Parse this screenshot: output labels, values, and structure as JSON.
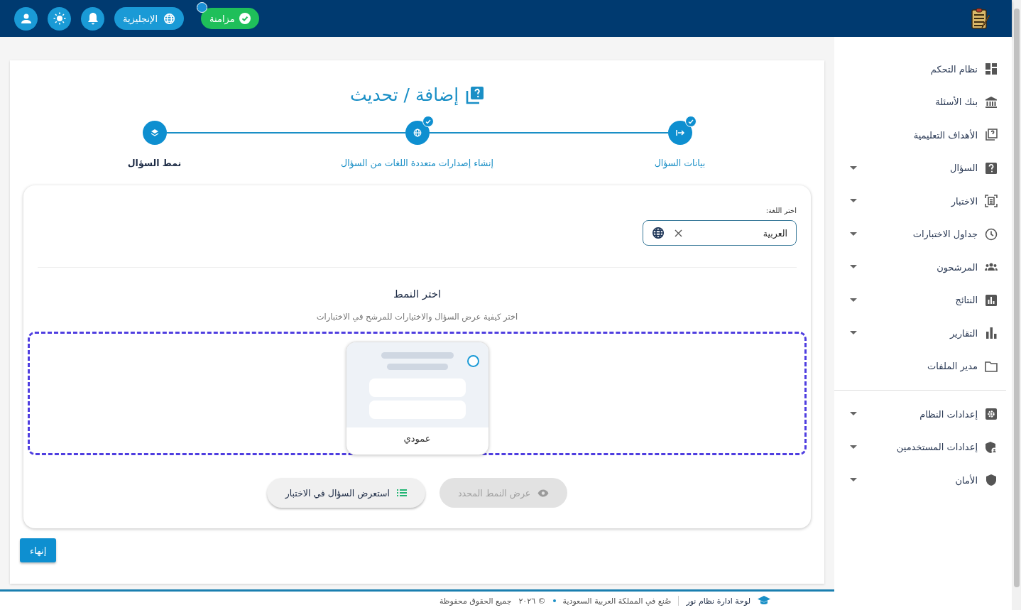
{
  "topbar": {
    "sync": {
      "label": "مزامنة",
      "synced": true
    },
    "language_button": "الإنجليزية"
  },
  "sidebar": {
    "sections": [
      {
        "items": [
          {
            "label": "نظام التحكم",
            "expandable": false
          },
          {
            "label": "بنك الأسئلة",
            "expandable": false
          },
          {
            "label": "الأهداف التعليمية",
            "expandable": false
          },
          {
            "label": "السؤال",
            "expandable": true
          },
          {
            "label": "الاختبار",
            "expandable": true
          },
          {
            "label": "جداول الاختبارات",
            "expandable": true
          },
          {
            "label": "المرشحون",
            "expandable": true
          },
          {
            "label": "النتائج",
            "expandable": true
          },
          {
            "label": "التقارير",
            "expandable": true
          },
          {
            "label": "مدير الملفات",
            "expandable": false
          }
        ]
      },
      {
        "items": [
          {
            "label": "إعدادات النظام",
            "expandable": true
          },
          {
            "label": "إعدادات المستخدمين",
            "expandable": true
          },
          {
            "label": "الأمان",
            "expandable": true
          }
        ]
      }
    ]
  },
  "page": {
    "title": "إضافة / تحديث",
    "steps": [
      {
        "label": "بيانات السؤال",
        "completed": true,
        "selected": false
      },
      {
        "label": "إنشاء إصدارات متعددة اللغات من السؤال",
        "completed": true,
        "selected": false
      },
      {
        "label": "نمط السؤال",
        "completed": false,
        "selected": true
      }
    ],
    "language_field": {
      "label": "اختر اللغة:",
      "value": "العربية"
    },
    "style_section": {
      "title": "اختر النمط",
      "subtitle": "اختر كيفية عرض السؤال والاختيارات للمرشح في الاختبارات",
      "options": [
        {
          "label": "عمودي",
          "selected": false
        }
      ]
    },
    "buttons": [
      {
        "label": "عرض النمط المحدد",
        "disabled": true,
        "kind": "view"
      },
      {
        "label": "استعرض السؤال في الاختبار",
        "disabled": false,
        "kind": "preview"
      }
    ],
    "finish_button": "إنهاء"
  },
  "footer": {
    "brand": "لوحة ادارة نظام نور",
    "made_in": "صُنع في المملكة العربية السعودية",
    "year": "© ٢٠٢٦",
    "rights": "جميع الحقوق محفوظة"
  }
}
